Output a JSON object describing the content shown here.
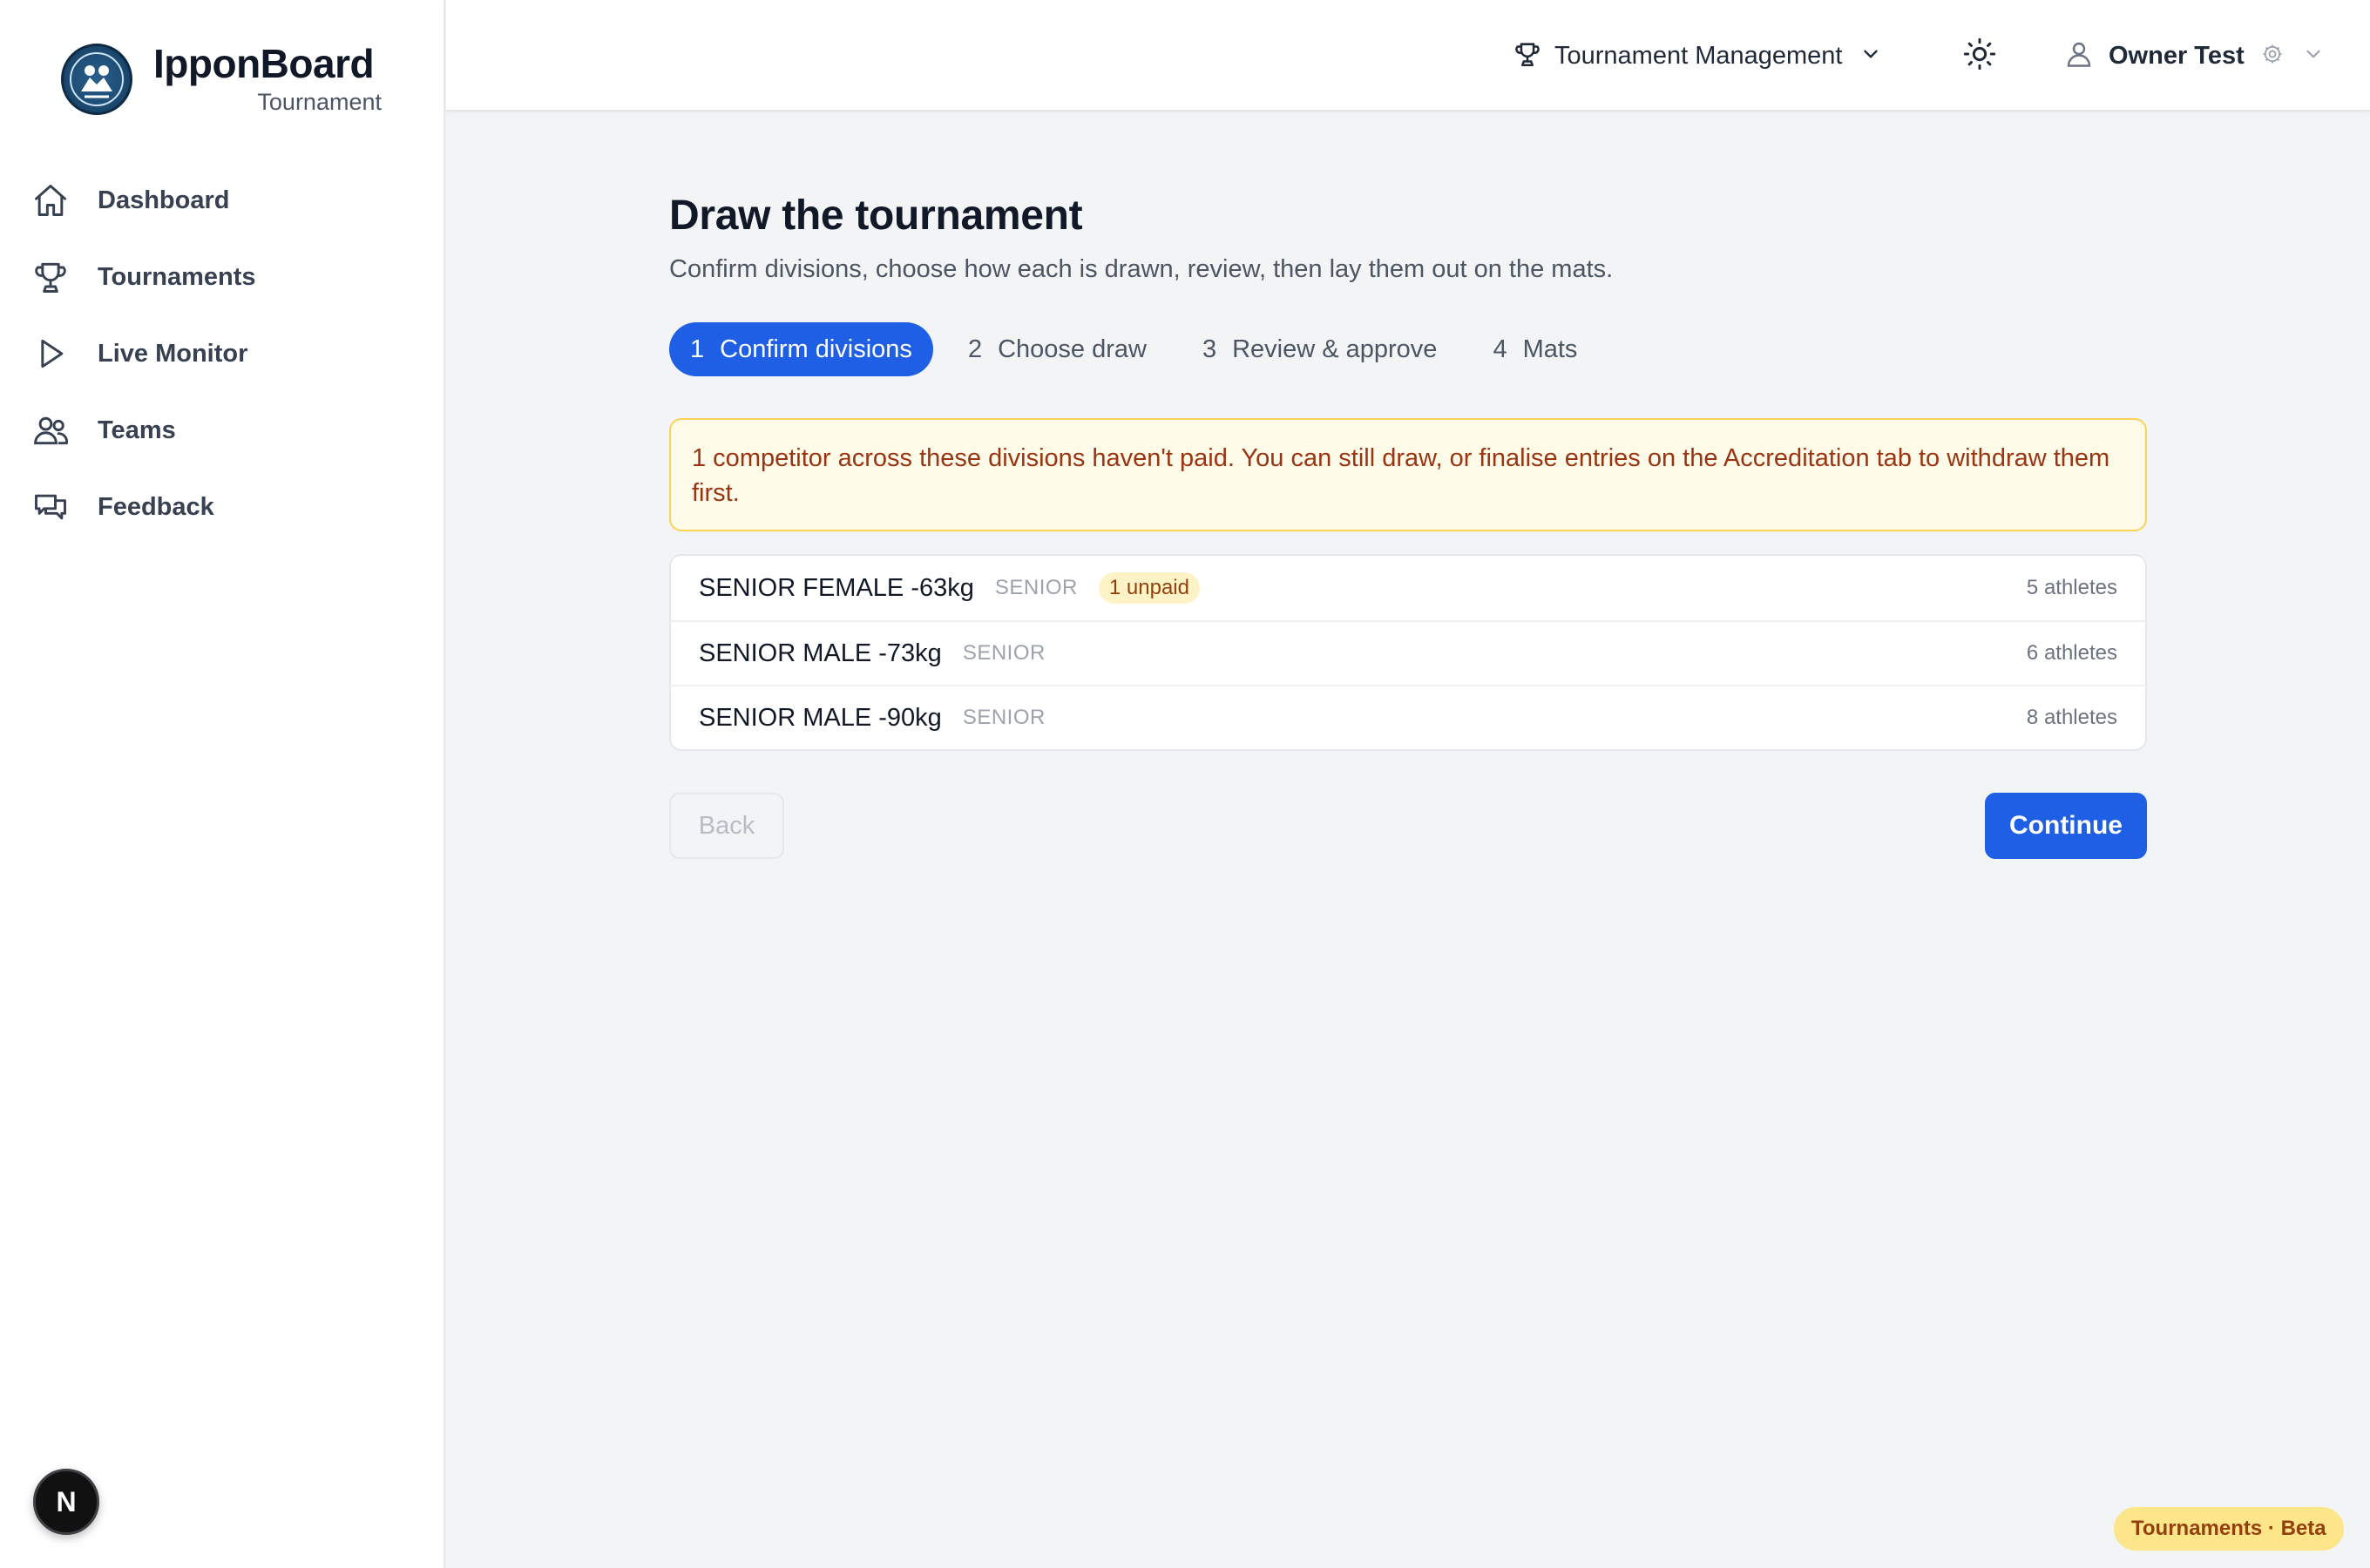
{
  "brand": {
    "title": "IpponBoard",
    "subtitle": "Tournament"
  },
  "sidebar": {
    "items": [
      {
        "label": "Dashboard",
        "icon": "home-icon"
      },
      {
        "label": "Tournaments",
        "icon": "trophy-icon"
      },
      {
        "label": "Live Monitor",
        "icon": "play-icon"
      },
      {
        "label": "Teams",
        "icon": "users-icon"
      },
      {
        "label": "Feedback",
        "icon": "chat-icon"
      }
    ],
    "badge": "N"
  },
  "topbar": {
    "menu_label": "Tournament Management",
    "user_name": "Owner Test"
  },
  "page": {
    "title": "Draw the tournament",
    "subtitle": "Confirm divisions, choose how each is drawn, review, then lay them out on the mats."
  },
  "steps": [
    {
      "num": "1",
      "label": "Confirm divisions",
      "active": true
    },
    {
      "num": "2",
      "label": "Choose draw",
      "active": false
    },
    {
      "num": "3",
      "label": "Review & approve",
      "active": false
    },
    {
      "num": "4",
      "label": "Mats",
      "active": false
    }
  ],
  "alert": {
    "text": "1 competitor across these divisions haven't paid. You can still draw, or finalise entries on the Accreditation tab to withdraw them first."
  },
  "divisions": [
    {
      "name": "SENIOR FEMALE -63kg",
      "category": "SENIOR",
      "unpaid": "1 unpaid",
      "count": "5 athletes"
    },
    {
      "name": "SENIOR MALE -73kg",
      "category": "SENIOR",
      "unpaid": "",
      "count": "6 athletes"
    },
    {
      "name": "SENIOR MALE -90kg",
      "category": "SENIOR",
      "unpaid": "",
      "count": "8 athletes"
    }
  ],
  "actions": {
    "back_label": "Back",
    "continue_label": "Continue"
  },
  "footer_badge": "Tournaments · Beta",
  "colors": {
    "accent": "#1f5fe6",
    "warning_bg": "#fefce8",
    "warning_border": "#fbd35a",
    "warning_text": "#9a3412"
  }
}
